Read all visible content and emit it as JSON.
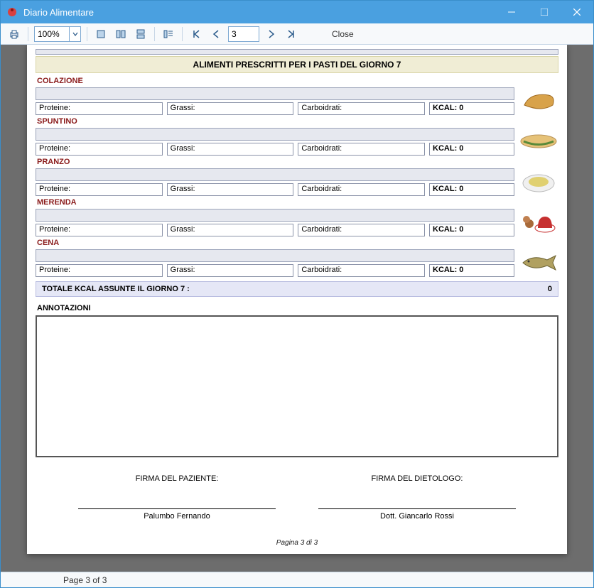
{
  "window": {
    "title": "Diario Alimentare"
  },
  "toolbar": {
    "zoom": "100%",
    "page_input": "3",
    "close_label": "Close"
  },
  "banner": "ALIMENTI PRESCRITTI PER I PASTI DEL GIORNO 7",
  "labels": {
    "proteine": "Proteine:",
    "grassi": "Grassi:",
    "carboidrati": "Carboidrati:",
    "kcal_prefix": "KCAL: "
  },
  "meals": [
    {
      "name": "COLAZIONE",
      "kcal": 0,
      "icon": "croissant"
    },
    {
      "name": "SPUNTINO",
      "kcal": 0,
      "icon": "sandwich"
    },
    {
      "name": "PRANZO",
      "kcal": 0,
      "icon": "plate"
    },
    {
      "name": "MERENDA",
      "kcal": 0,
      "icon": "tea"
    },
    {
      "name": "CENA",
      "kcal": 0,
      "icon": "fish"
    }
  ],
  "total": {
    "label": "TOTALE KCAL ASSUNTE IL GIORNO 7 :",
    "value": "0"
  },
  "annotations_title": "ANNOTAZIONI",
  "signatures": {
    "patient_label": "FIRMA DEL PAZIENTE:",
    "doctor_label": "FIRMA DEL DIETOLOGO:",
    "patient_name": "Palumbo Fernando",
    "doctor_name": "Dott. Giancarlo Rossi"
  },
  "page_footer": "Pagina 3 di 3",
  "statusbar": "Page 3 of 3"
}
